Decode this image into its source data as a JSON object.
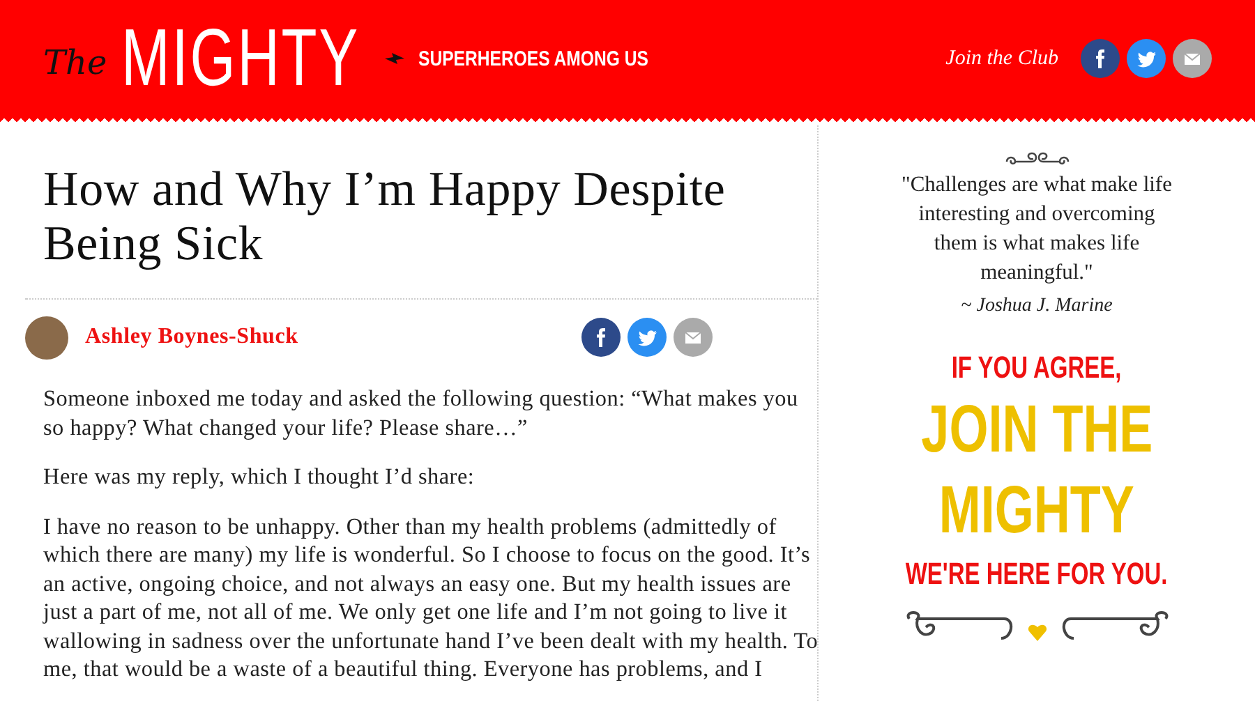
{
  "header": {
    "logo_small": "The",
    "logo_big": "MIGHTY",
    "tagline": "SUPERHEROES AMONG US",
    "join_link": "Join the Club",
    "social": [
      {
        "kind": "facebook"
      },
      {
        "kind": "twitter"
      },
      {
        "kind": "email"
      }
    ]
  },
  "article": {
    "title": "How and Why I’m Happy Despite Being Sick",
    "author": "Ashley Boynes-Shuck",
    "share": [
      {
        "kind": "facebook"
      },
      {
        "kind": "twitter"
      },
      {
        "kind": "email"
      }
    ],
    "paragraphs": [
      "Someone inboxed me today and asked the following question: “What makes you so happy? What changed your life? Please share…”",
      "Here was my reply, which I thought I’d share:",
      "I have no reason to be unhappy. Other than my health problems (admittedly of which there are many) my life is wonderful. So I choose to focus on the good. It’s an active, ongoing choice, and not always an easy one. But my health issues are just a part of me, not all of me. We only get one life and I’m not going to live it wallowing in sadness over the unfortunate hand I’ve been dealt with my health. To me, that would be a waste of a beautiful thing. Everyone has problems, and I"
    ]
  },
  "sidebar": {
    "quote": "\"Challenges are what make life interesting and overcoming them is what makes life meaningful.\"",
    "quote_author": "~ Joshua J. Marine",
    "promo": [
      {
        "kind": "small",
        "text": "IF YOU AGREE,"
      },
      {
        "kind": "big",
        "text": "JOIN THE"
      },
      {
        "kind": "big",
        "text": "MIGHTY"
      },
      {
        "kind": "small",
        "text": "WE'RE HERE FOR YOU."
      }
    ]
  }
}
